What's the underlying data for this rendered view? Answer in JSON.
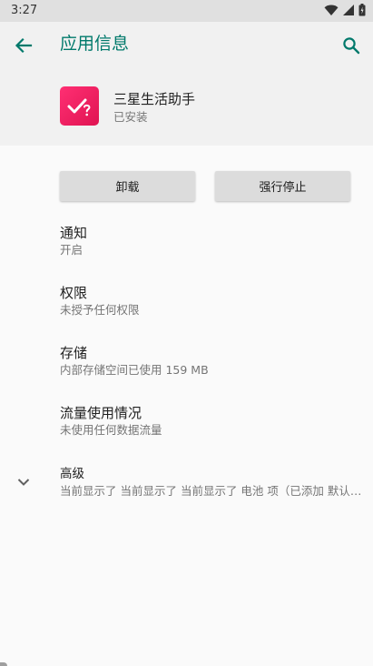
{
  "status_bar": {
    "time": "3:27"
  },
  "header": {
    "title": "应用信息",
    "back_icon": "arrow-back-icon",
    "search_icon": "search-icon"
  },
  "app": {
    "name": "三星生活助手",
    "status": "已安装",
    "icon_color": "#f0225f"
  },
  "buttons": {
    "uninstall": "卸载",
    "force_stop": "强行停止"
  },
  "preferences": [
    {
      "title": "通知",
      "summary": "开启"
    },
    {
      "title": "权限",
      "summary": "未授予任何权限"
    },
    {
      "title": "存储",
      "summary": "内部存储空间已使用 159 MB"
    },
    {
      "title": "流量使用情况",
      "summary": "未使用任何数据流量"
    }
  ],
  "advanced": {
    "title": "高级",
    "summary": "当前显示了 当前显示了 当前显示了 电池 项（已添加 默认打开、电池、存储、内存、高级）"
  },
  "colors": {
    "accent": "#00796b",
    "header_bg": "#f1f1f1",
    "status_bar_bg": "#e0e0e0"
  }
}
